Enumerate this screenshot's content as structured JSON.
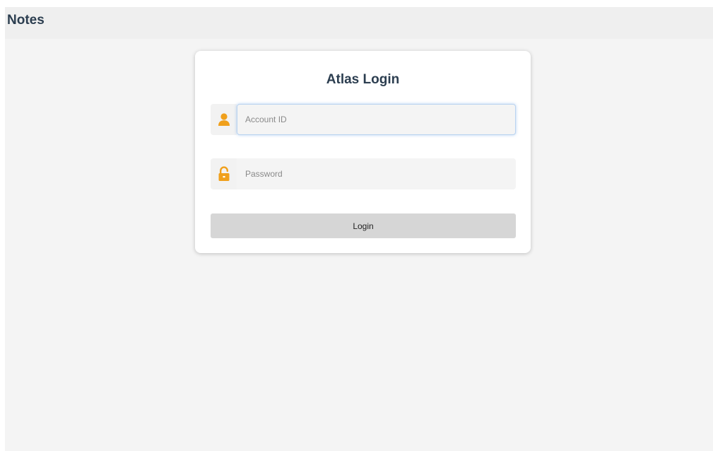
{
  "header": {
    "title": "Notes"
  },
  "login": {
    "title": "Atlas Login",
    "account_field": {
      "placeholder": "Account ID",
      "value": "",
      "icon": "user-icon"
    },
    "password_field": {
      "placeholder": "Password",
      "value": "",
      "icon": "unlock-icon"
    },
    "submit_label": "Login"
  },
  "colors": {
    "accent_icon": "#f0a01c",
    "title_text": "#2c3e50",
    "button_bg": "#d6d6d6",
    "focus_border": "#b9d3f0"
  }
}
